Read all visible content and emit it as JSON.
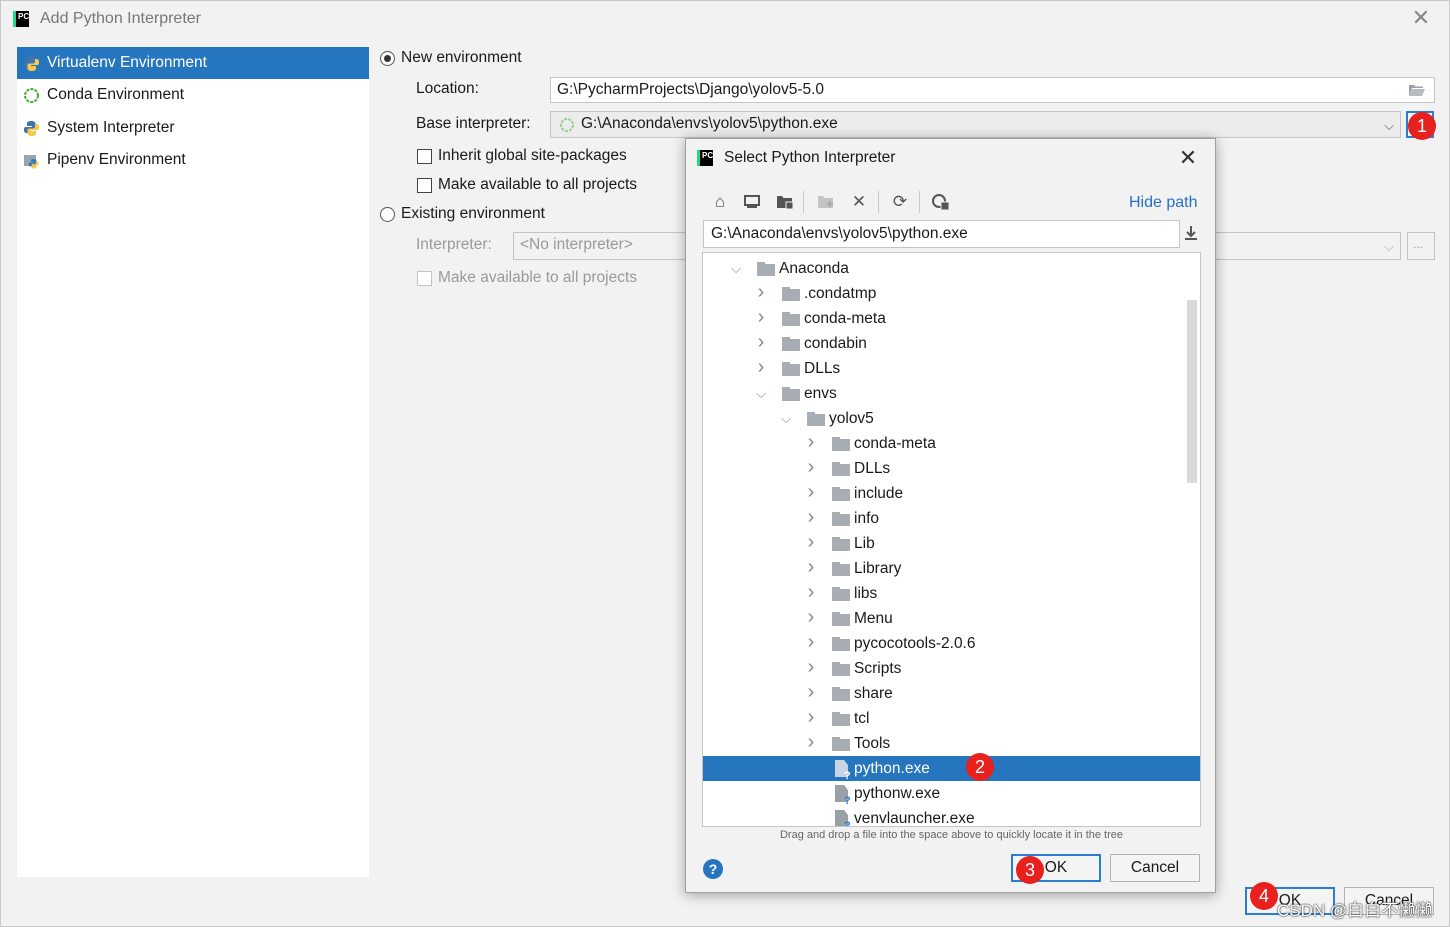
{
  "window": {
    "title": "Add Python Interpreter"
  },
  "left_panel": {
    "items": [
      {
        "label": "Virtualenv Environment",
        "icon": "virtualenv-icon",
        "selected": true
      },
      {
        "label": "Conda Environment",
        "icon": "conda-icon",
        "selected": false
      },
      {
        "label": "System Interpreter",
        "icon": "python-icon",
        "selected": false
      },
      {
        "label": "Pipenv Environment",
        "icon": "pipenv-icon",
        "selected": false
      }
    ]
  },
  "form": {
    "new_env_label": "New environment",
    "location_label": "Location:",
    "location_value": "G:\\PycharmProjects\\Django\\yolov5-5.0",
    "base_interpreter_label": "Base interpreter:",
    "base_interpreter_value": "G:\\Anaconda\\envs\\yolov5\\python.exe",
    "inherit_label": "Inherit global site-packages",
    "make_available_label": "Make available to all projects",
    "existing_env_label": "Existing environment",
    "interpreter_label": "Interpreter:",
    "interpreter_value": "<No interpreter>",
    "make_available_label_2": "Make available to all projects",
    "browse_button": "...",
    "ok_button": "OK",
    "cancel_button": "Cancel"
  },
  "dialog": {
    "title": "Select Python Interpreter",
    "hide_path_link": "Hide path",
    "path_value": "G:\\Anaconda\\envs\\yolov5\\python.exe",
    "hint": "Drag and drop a file into the space above to quickly locate it in the tree",
    "ok_button": "OK",
    "cancel_button": "Cancel",
    "help": "?",
    "toolbar_icons": [
      "home-icon",
      "desktop-icon",
      "project-folder-icon",
      "new-folder-icon",
      "delete-icon",
      "refresh-icon",
      "show-hidden-icon"
    ],
    "tree": [
      {
        "name": "Anaconda",
        "depth": 0,
        "type": "folder",
        "expanded": true
      },
      {
        "name": ".condatmp",
        "depth": 1,
        "type": "folder",
        "expanded": false
      },
      {
        "name": "conda-meta",
        "depth": 1,
        "type": "folder",
        "expanded": false
      },
      {
        "name": "condabin",
        "depth": 1,
        "type": "folder",
        "expanded": false
      },
      {
        "name": "DLLs",
        "depth": 1,
        "type": "folder",
        "expanded": false
      },
      {
        "name": "envs",
        "depth": 1,
        "type": "folder",
        "expanded": true
      },
      {
        "name": "yolov5",
        "depth": 2,
        "type": "folder",
        "expanded": true
      },
      {
        "name": "conda-meta",
        "depth": 3,
        "type": "folder",
        "expanded": false
      },
      {
        "name": "DLLs",
        "depth": 3,
        "type": "folder",
        "expanded": false
      },
      {
        "name": "include",
        "depth": 3,
        "type": "folder",
        "expanded": false
      },
      {
        "name": "info",
        "depth": 3,
        "type": "folder",
        "expanded": false
      },
      {
        "name": "Lib",
        "depth": 3,
        "type": "folder",
        "expanded": false
      },
      {
        "name": "Library",
        "depth": 3,
        "type": "folder",
        "expanded": false
      },
      {
        "name": "libs",
        "depth": 3,
        "type": "folder",
        "expanded": false
      },
      {
        "name": "Menu",
        "depth": 3,
        "type": "folder",
        "expanded": false
      },
      {
        "name": "pycocotools-2.0.6",
        "depth": 3,
        "type": "folder",
        "expanded": false
      },
      {
        "name": "Scripts",
        "depth": 3,
        "type": "folder",
        "expanded": false
      },
      {
        "name": "share",
        "depth": 3,
        "type": "folder",
        "expanded": false
      },
      {
        "name": "tcl",
        "depth": 3,
        "type": "folder",
        "expanded": false
      },
      {
        "name": "Tools",
        "depth": 3,
        "type": "folder",
        "expanded": false
      },
      {
        "name": "python.exe",
        "depth": 3,
        "type": "file",
        "selected": true
      },
      {
        "name": "pythonw.exe",
        "depth": 3,
        "type": "file"
      },
      {
        "name": "venvlauncher.exe",
        "depth": 3,
        "type": "file"
      }
    ]
  },
  "badges": [
    "1",
    "2",
    "3",
    "4"
  ],
  "watermark": "CSDN @白白不懒懒",
  "colors": {
    "selection": "#2675bf",
    "badge": "#e8201e",
    "link": "#2470c9"
  }
}
